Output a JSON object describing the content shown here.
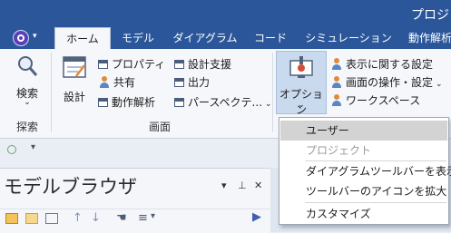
{
  "window": {
    "title": "プロジ"
  },
  "tabs": [
    {
      "label": "ホーム",
      "active": true
    },
    {
      "label": "モデル",
      "active": false
    },
    {
      "label": "ダイアグラム",
      "active": false
    },
    {
      "label": "コード",
      "active": false
    },
    {
      "label": "シミュレーション",
      "active": false
    },
    {
      "label": "動作解析",
      "active": false
    }
  ],
  "ribbon": {
    "search": {
      "label": "検索",
      "group": "探索"
    },
    "design": {
      "label": "設計"
    },
    "screen_group": {
      "label": "画面",
      "col1": [
        "プロパティ",
        "共有",
        "動作解析"
      ],
      "col2": [
        "設計支援",
        "出力",
        "パースペクテ..."
      ]
    },
    "options": {
      "label": "オプション"
    },
    "settings": [
      "表示に関する設定",
      "画面の操作・設定",
      "ワークスペース"
    ]
  },
  "dropdown": {
    "items": [
      {
        "label": "ユーザー",
        "state": "selected"
      },
      {
        "label": "プロジェクト",
        "state": "disabled"
      },
      {
        "label": "ダイアグラムツールバーを表示",
        "state": "normal"
      },
      {
        "label": "ツールバーのアイコンを拡大",
        "state": "normal"
      },
      {
        "label": "カスタマイズ",
        "state": "normal"
      }
    ]
  },
  "browser": {
    "title": "モデルブラウザ"
  },
  "colors": {
    "brand": "#2b579a",
    "ribbon_bg": "#f5f7fa",
    "highlight": "#c9d9ee"
  }
}
